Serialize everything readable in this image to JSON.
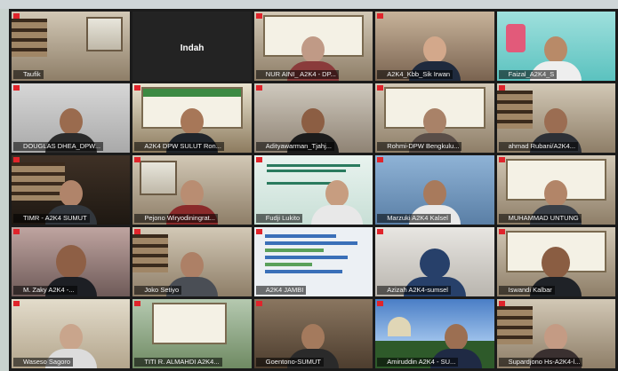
{
  "meeting": {
    "participants": [
      {
        "name": "Taufik"
      },
      {
        "name": "Indah",
        "video": false
      },
      {
        "name": "NUR AINI_ A2K4 - DP..."
      },
      {
        "name": "A2K4_Kbb_Sik Irwan"
      },
      {
        "name": "Faizal_A2K4_S",
        "active_speaker": true
      },
      {
        "name": "DOUGLAS DHEA_DPW..."
      },
      {
        "name": "A2K4 DPW SULUT Ron..."
      },
      {
        "name": "Adityawarman_Tjahj..."
      },
      {
        "name": "Rohmi-DPW Bengkulu..."
      },
      {
        "name": "ahmad Rubani/A2K4..."
      },
      {
        "name": "TIMR - A2K4 SUMUT"
      },
      {
        "name": "Pejono Wiryodiningrat..."
      },
      {
        "name": "Fudji Lukito"
      },
      {
        "name": "Marzuki A2K4 Kalsel"
      },
      {
        "name": "MUHAMMAD UNTUNG"
      },
      {
        "name": "M. Zaky A2K4 -..."
      },
      {
        "name": "Joko Setiyo"
      },
      {
        "name": "A2K4 JAMBI"
      },
      {
        "name": "Azizah A2K4-sumsel"
      },
      {
        "name": "Iswandi Kalbar"
      },
      {
        "name": "Waseso Sagoro"
      },
      {
        "name": "TITI R. ALMAHDI A2K4..."
      },
      {
        "name": "Goentono-SUMUT"
      },
      {
        "name": "Amiruddin A2K4 - SU..."
      },
      {
        "name": "Supardjono Hs-A2K4-l..."
      }
    ]
  },
  "colors": {
    "mic_muted": "#e0242b",
    "active_speaker_border": "#f1d84b",
    "grid_background": "#1b1b1b"
  },
  "icons": {
    "mic": "mic-muted-icon"
  }
}
